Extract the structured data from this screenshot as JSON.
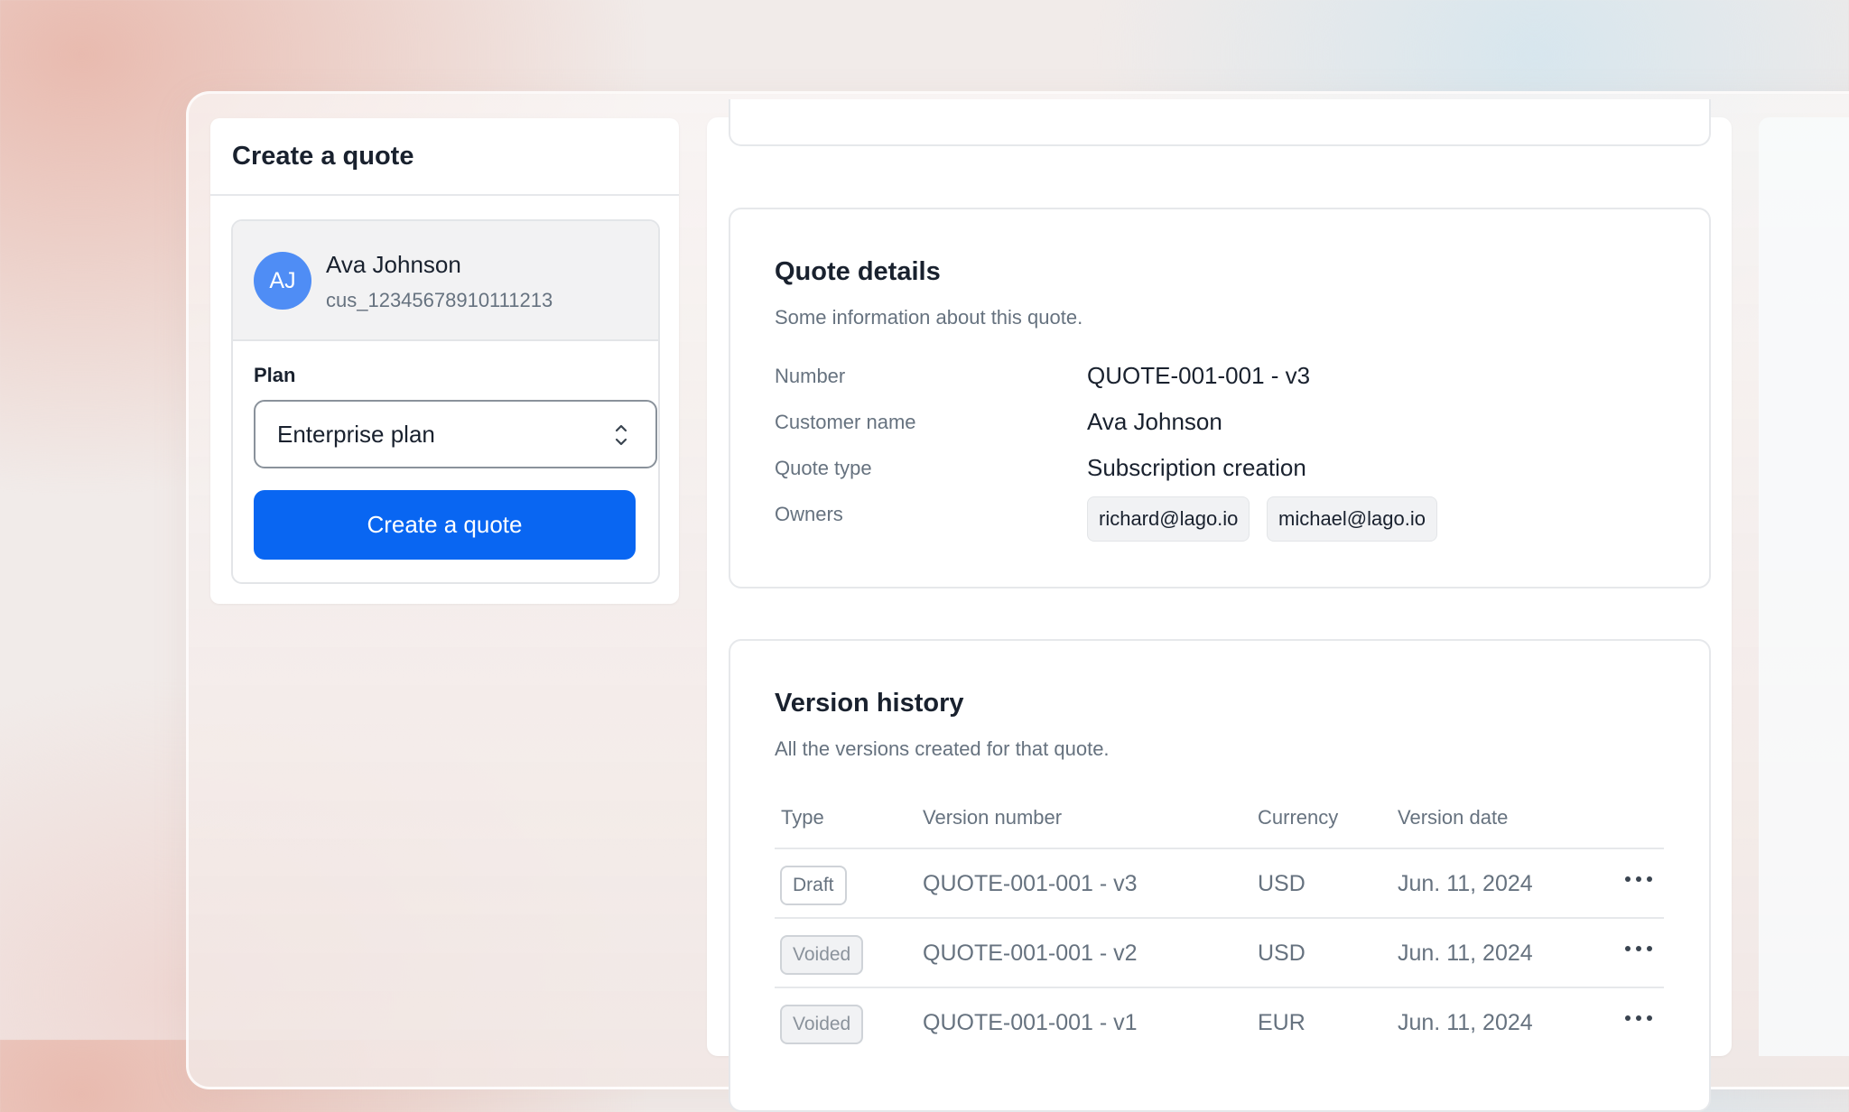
{
  "create_panel": {
    "title": "Create a quote",
    "customer": {
      "initials": "AJ",
      "name": "Ava Johnson",
      "id": "cus_12345678910111213"
    },
    "plan_label": "Plan",
    "plan_value": "Enterprise plan",
    "button_label": "Create a quote"
  },
  "quote_details": {
    "title": "Quote details",
    "subtitle": "Some information about this quote.",
    "fields": [
      {
        "label": "Number",
        "value": "QUOTE-001-001 - v3"
      },
      {
        "label": "Customer name",
        "value": "Ava Johnson"
      },
      {
        "label": "Quote type",
        "value": "Subscription creation"
      },
      {
        "label": "Owners"
      }
    ],
    "owners": [
      "richard@lago.io",
      "michael@lago.io"
    ]
  },
  "version_history": {
    "title": "Version history",
    "subtitle": "All the versions created for that quote.",
    "columns": [
      "Type",
      "Version number",
      "Currency",
      "Version date"
    ],
    "rows": [
      {
        "type": "Draft",
        "version": "QUOTE-001-001 - v3",
        "currency": "USD",
        "date": "Jun. 11, 2024"
      },
      {
        "type": "Voided",
        "version": "QUOTE-001-001 - v2",
        "currency": "USD",
        "date": "Jun. 11, 2024"
      },
      {
        "type": "Voided",
        "version": "QUOTE-001-001 - v1",
        "currency": "EUR",
        "date": "Jun. 11, 2024"
      }
    ]
  },
  "colors": {
    "primary_button": "#0966f2",
    "avatar": "#4f8df5",
    "text": "#19212e",
    "muted": "#66727f"
  },
  "icons": {
    "plan_select": "chevron-up-down-icon",
    "row_actions": "more-horizontal-icon"
  }
}
